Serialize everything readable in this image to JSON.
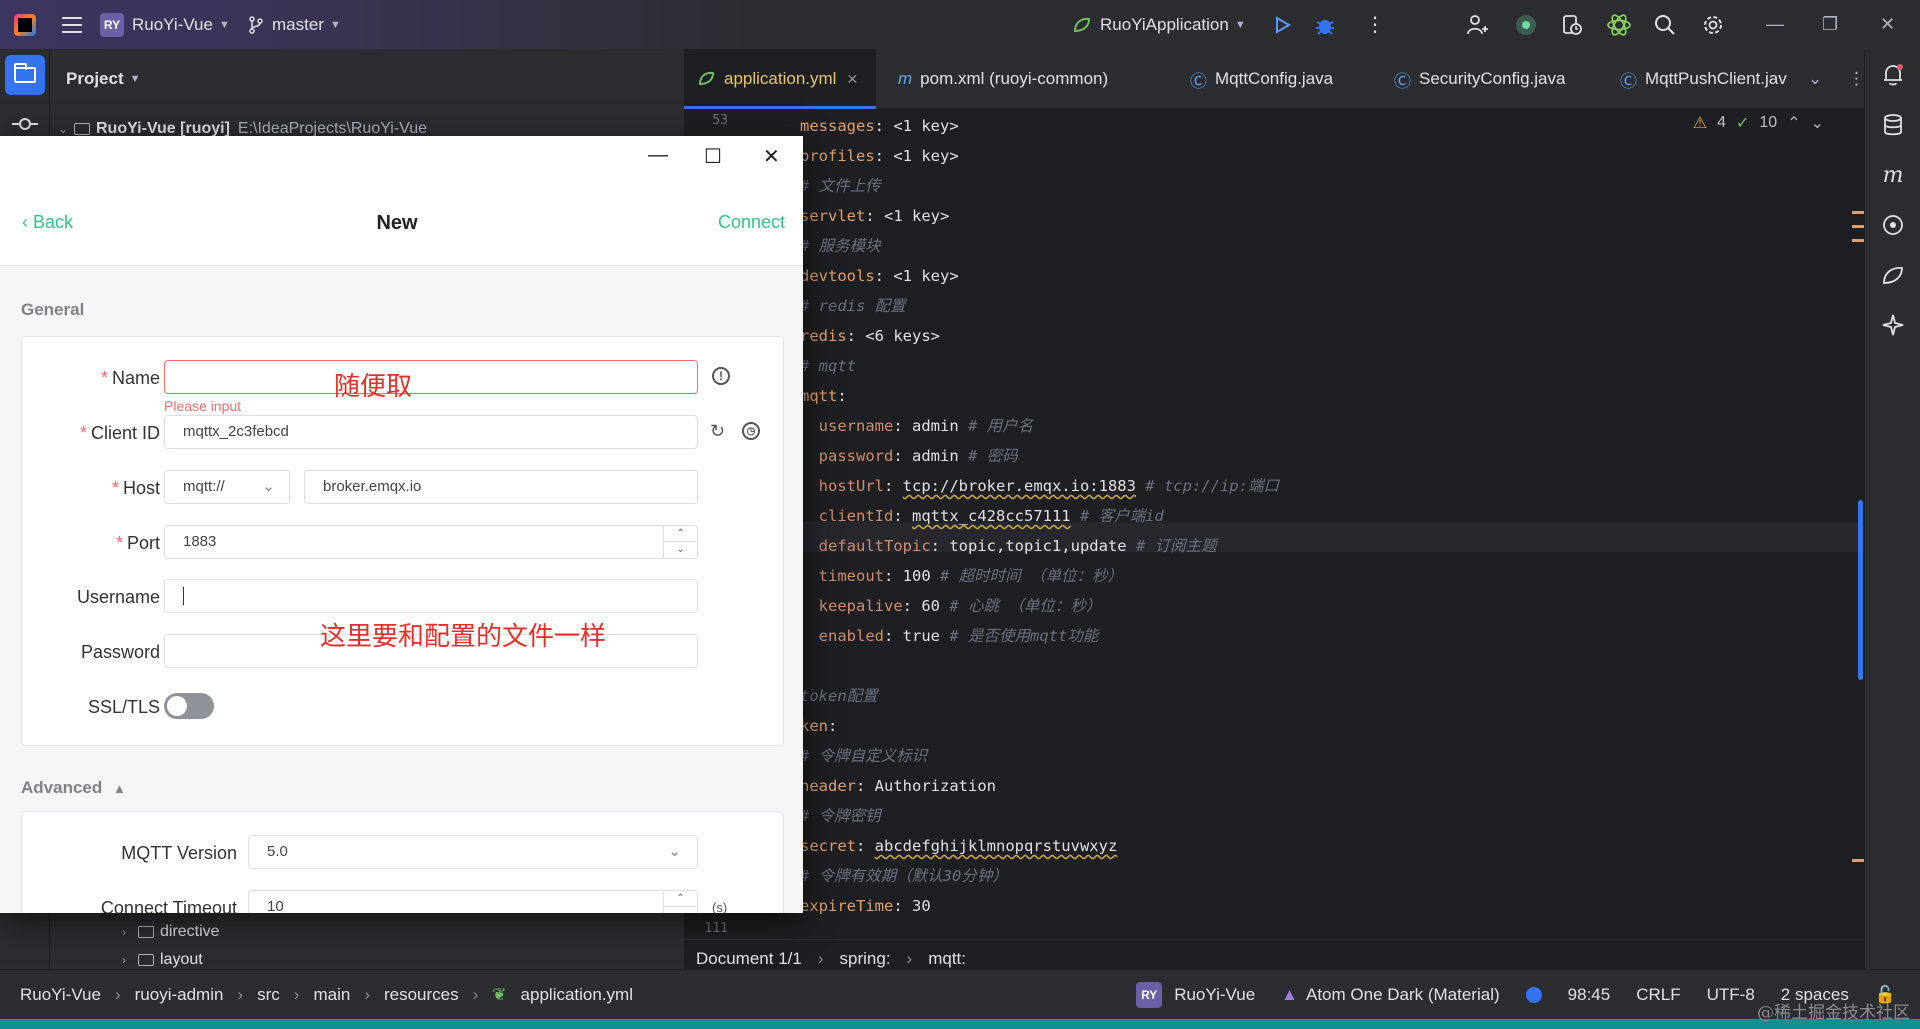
{
  "titlebar": {
    "project_badge": "RY",
    "project_name": "RuoYi-Vue",
    "branch": "master",
    "run_config": "RuoYiApplication"
  },
  "project_panel": {
    "title": "Project",
    "root_label": "RuoYi-Vue [ruoyi]",
    "root_path": "E:\\IdeaProjects\\RuoYi-Vue",
    "items": [
      "directive",
      "layout"
    ]
  },
  "tabs": [
    {
      "label": "application.yml",
      "active": true
    },
    {
      "label": "pom.xml (ruoyi-common)",
      "icon": "m"
    },
    {
      "label": "MqttConfig.java",
      "icon": "C"
    },
    {
      "label": "SecurityConfig.java",
      "icon": "C"
    },
    {
      "label": "MqttPushClient.jav",
      "icon": "C"
    }
  ],
  "editor": {
    "first_line_number": "53",
    "last_line_number": "111",
    "warnings": "4",
    "checks": "10",
    "lines": [
      {
        "key": "messages",
        "value": "<1 key>",
        "folded": true
      },
      {
        "key": "profiles",
        "value": "<1 key>",
        "folded": true
      },
      {
        "comment": "# 文件上传"
      },
      {
        "key": "servlet",
        "value": "<1 key>",
        "folded": true
      },
      {
        "comment": "# 服务模块"
      },
      {
        "key": "devtools",
        "value": "<1 key>",
        "folded": true
      },
      {
        "comment": "# redis 配置"
      },
      {
        "key": "redis",
        "value": "<6 keys>",
        "folded": true
      },
      {
        "comment": "# mqtt"
      },
      {
        "key": "mqtt",
        "value": ""
      },
      {
        "key": "username",
        "value": "admin",
        "comment": "# 用户名",
        "indent": true
      },
      {
        "key": "password",
        "value": "admin",
        "comment": "# 密码",
        "indent": true
      },
      {
        "key": "hostUrl",
        "value": "tcp://broker.emqx.io:1883",
        "comment": "# tcp://ip:端口",
        "indent": true
      },
      {
        "key": "clientId",
        "value": "mqttx_c428cc57111",
        "comment": "# 客户端id",
        "indent": true
      },
      {
        "key": "defaultTopic",
        "value": "topic,topic1,update",
        "comment": "# 订阅主题",
        "indent": true
      },
      {
        "key": "timeout",
        "value": "100",
        "comment": "# 超时时间 （单位：秒）",
        "indent": true
      },
      {
        "key": "keepalive",
        "value": "60",
        "comment": "# 心跳 （单位：秒）",
        "indent": true
      },
      {
        "key": "enabled",
        "value": "true",
        "comment": "# 是否使用mqtt功能",
        "indent": true
      },
      {
        "blank": true
      },
      {
        "comment": "token配置"
      },
      {
        "key": "ken",
        "value": ""
      },
      {
        "comment": "# 令牌自定义标识"
      },
      {
        "key": "header",
        "value": "Authorization"
      },
      {
        "comment": "# 令牌密钥"
      },
      {
        "key": "secret",
        "value": "abcdefghijklmnopqrstuvwxyz"
      },
      {
        "comment": "# 令牌有效期（默认30分钟）"
      },
      {
        "key": "expireTime",
        "value": "30"
      }
    ]
  },
  "editor_breadcrumb": [
    "Document 1/1",
    "spring:",
    "mqtt:"
  ],
  "statusbar": {
    "path": [
      "RuoYi-Vue",
      "ruoyi-admin",
      "src",
      "main",
      "resources",
      "application.yml"
    ],
    "project_badge": "RY",
    "project": "RuoYi-Vue",
    "theme": "Atom One Dark (Material)",
    "position": "98:45",
    "line_sep": "CRLF",
    "encoding": "UTF-8",
    "indent": "2 spaces"
  },
  "watermark": "@稀土掘金技术社区",
  "dialog": {
    "back_label": "Back",
    "title": "New",
    "connect_label": "Connect",
    "general_title": "General",
    "name_label": "Name",
    "name_value": "",
    "name_error": "Please input",
    "client_id_label": "Client ID",
    "client_id_value": "mqttx_2c3febcd",
    "host_label": "Host",
    "protocol_value": "mqtt://",
    "host_value": "broker.emqx.io",
    "port_label": "Port",
    "port_value": "1883",
    "username_label": "Username",
    "username_value": "",
    "password_label": "Password",
    "password_value": "",
    "ssl_label": "SSL/TLS",
    "ssl_enabled": false,
    "advanced_title": "Advanced",
    "mqtt_version_label": "MQTT Version",
    "mqtt_version_value": "5.0",
    "connect_timeout_label": "Connect Timeout",
    "connect_timeout_value": "10",
    "connect_timeout_unit": "(s)",
    "annotation_name": "随便取",
    "annotation_config": "这里要和配置的文件一样"
  },
  "colors": {
    "accent_green": "#34c388",
    "error_red": "#f56c6c",
    "ide_blue": "#3574f0"
  }
}
